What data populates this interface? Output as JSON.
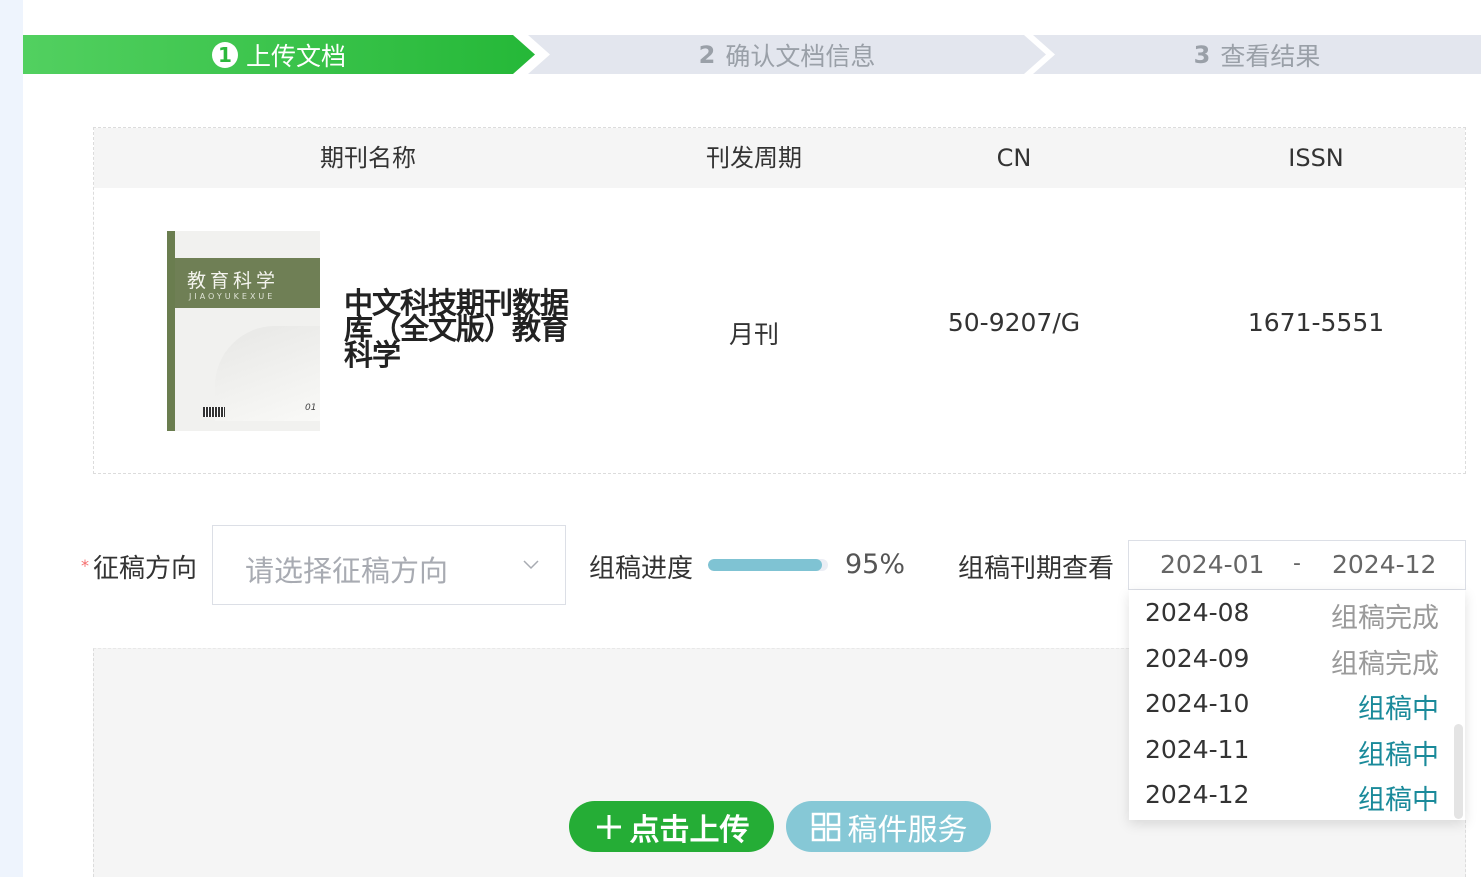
{
  "steps": [
    {
      "num": "1",
      "label": "上传文档"
    },
    {
      "num": "2",
      "label": "确认文档信息"
    },
    {
      "num": "3",
      "label": "查看结果"
    }
  ],
  "table": {
    "headers": [
      "期刊名称",
      "刊发周期",
      "CN",
      "ISSN"
    ],
    "journal_name": "中文科技期刊数据库（全文版）教育科学",
    "cycle": "月刊",
    "cn": "50-9207/G",
    "issn": "1671-5551",
    "cover": {
      "title": "教育科学",
      "sub": "JIAOYUKEXUE",
      "issue": "01"
    }
  },
  "form": {
    "direction_label": "征稿方向",
    "direction_placeholder": "请选择征稿方向",
    "progress_label": "组稿进度",
    "progress_value": 0.95,
    "progress_text": "95%",
    "period_label": "组稿刊期查看",
    "date_start": "2024-01",
    "date_sep": "-",
    "date_end": "2024-12"
  },
  "dropdown": [
    {
      "date": "2024-08",
      "status": "组稿完成",
      "color": "#9a9a9a"
    },
    {
      "date": "2024-09",
      "status": "组稿完成",
      "color": "#9a9a9a"
    },
    {
      "date": "2024-10",
      "status": "组稿中",
      "color": "#1a8a9a"
    },
    {
      "date": "2024-11",
      "status": "组稿中",
      "color": "#1a8a9a"
    },
    {
      "date": "2024-12",
      "status": "组稿中",
      "color": "#1a8a9a"
    }
  ],
  "buttons": {
    "upload": "点击上传",
    "service": "稿件服务"
  }
}
